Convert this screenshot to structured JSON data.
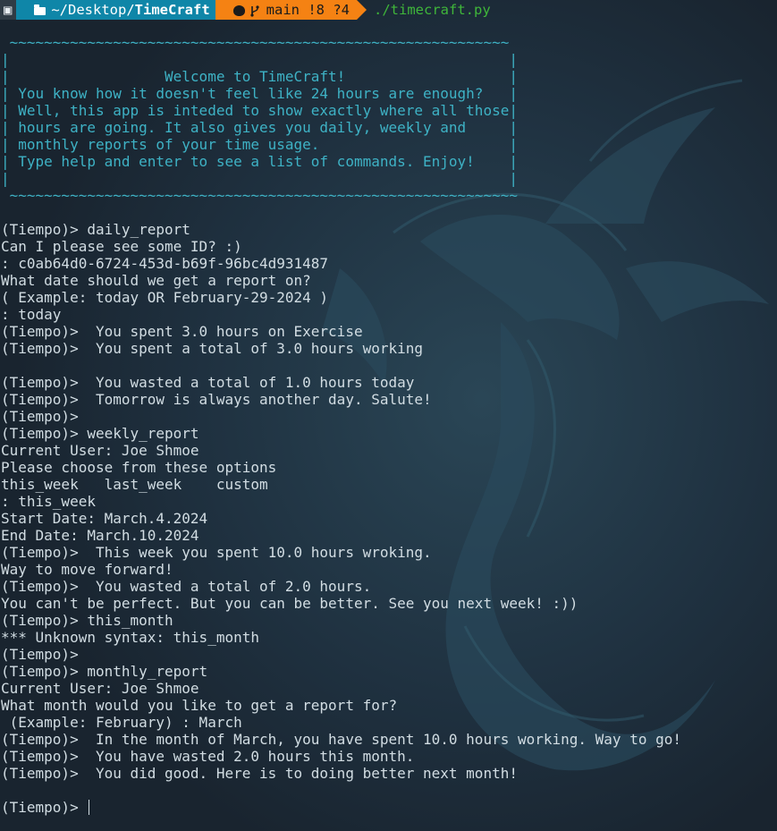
{
  "prompt": {
    "os_icon": "linux-logo-icon",
    "folder_icon": "folder-icon",
    "directory_prefix": "~/Desktop/",
    "directory_current": "TimeCraft",
    "git_icon": "github-icon",
    "branch_icon": "git-branch-icon",
    "git_status": "main !8 ?4",
    "command": "./timecraft.py"
  },
  "colors": {
    "background": "#1c2834",
    "dir_segment": "#0f86a8",
    "git_segment": "#f58213",
    "command": "#3fb53a",
    "banner": "#3eb2c5",
    "text": "#d2dde3"
  },
  "banner": [
    " ~~~~~~~~~~~~~~~~~~~~~~~~~~~~~~~~~~~~~~~~~~~~~~~~~~~~~~~~~~",
    "|                                                          |",
    "|                  Welcome to TimeCraft!                   |",
    "| You know how it doesn't feel like 24 hours are enough?   |",
    "| Well, this app is inteded to show exactly where all those|",
    "| hours are going. It also gives you daily, weekly and     |",
    "| monthly reports of your time usage.                      |",
    "| Type help and enter to see a list of commands. Enjoy!    |",
    "|                                                          |",
    " ~~~~~~~~~~~~~~~~~~~~~~~~~~~~~~~~~~~~~~~~~~~~~~~~~~~~~~~~~~~"
  ],
  "output": [
    "(Tiempo)> daily_report",
    "Can I please see some ID? :)",
    ": c0ab64d0-6724-453d-b69f-96bc4d931487",
    "What date should we get a report on?",
    "( Example: today OR February-29-2024 )",
    ": today",
    "(Tiempo)>  You spent 3.0 hours on Exercise",
    "(Tiempo)>  You spent a total of 3.0 hours working",
    "",
    "(Tiempo)>  You wasted a total of 1.0 hours today",
    "(Tiempo)>  Tomorrow is always another day. Salute!",
    "(Tiempo)>",
    "(Tiempo)> weekly_report",
    "Current User: Joe Shmoe",
    "Please choose from these options",
    "this_week   last_week    custom",
    ": this_week",
    "Start Date: March.4.2024",
    "End Date: March.10.2024",
    "(Tiempo)>  This week you spent 10.0 hours wroking.",
    "Way to move forward!",
    "(Tiempo)>  You wasted a total of 2.0 hours.",
    "You can't be perfect. But you can be better. See you next week! :))",
    "(Tiempo)> this_month",
    "*** Unknown syntax: this_month",
    "(Tiempo)>",
    "(Tiempo)> monthly_report",
    "Current User: Joe Shmoe",
    "What month would you like to get a report for?",
    " (Example: February) : March",
    "(Tiempo)>  In the month of March, you have spent 10.0 hours working. Way to go!",
    "(Tiempo)>  You have wasted 2.0 hours this month.",
    "(Tiempo)>  You did good. Here is to doing better next month!",
    ""
  ],
  "input_prompt": "(Tiempo)> "
}
